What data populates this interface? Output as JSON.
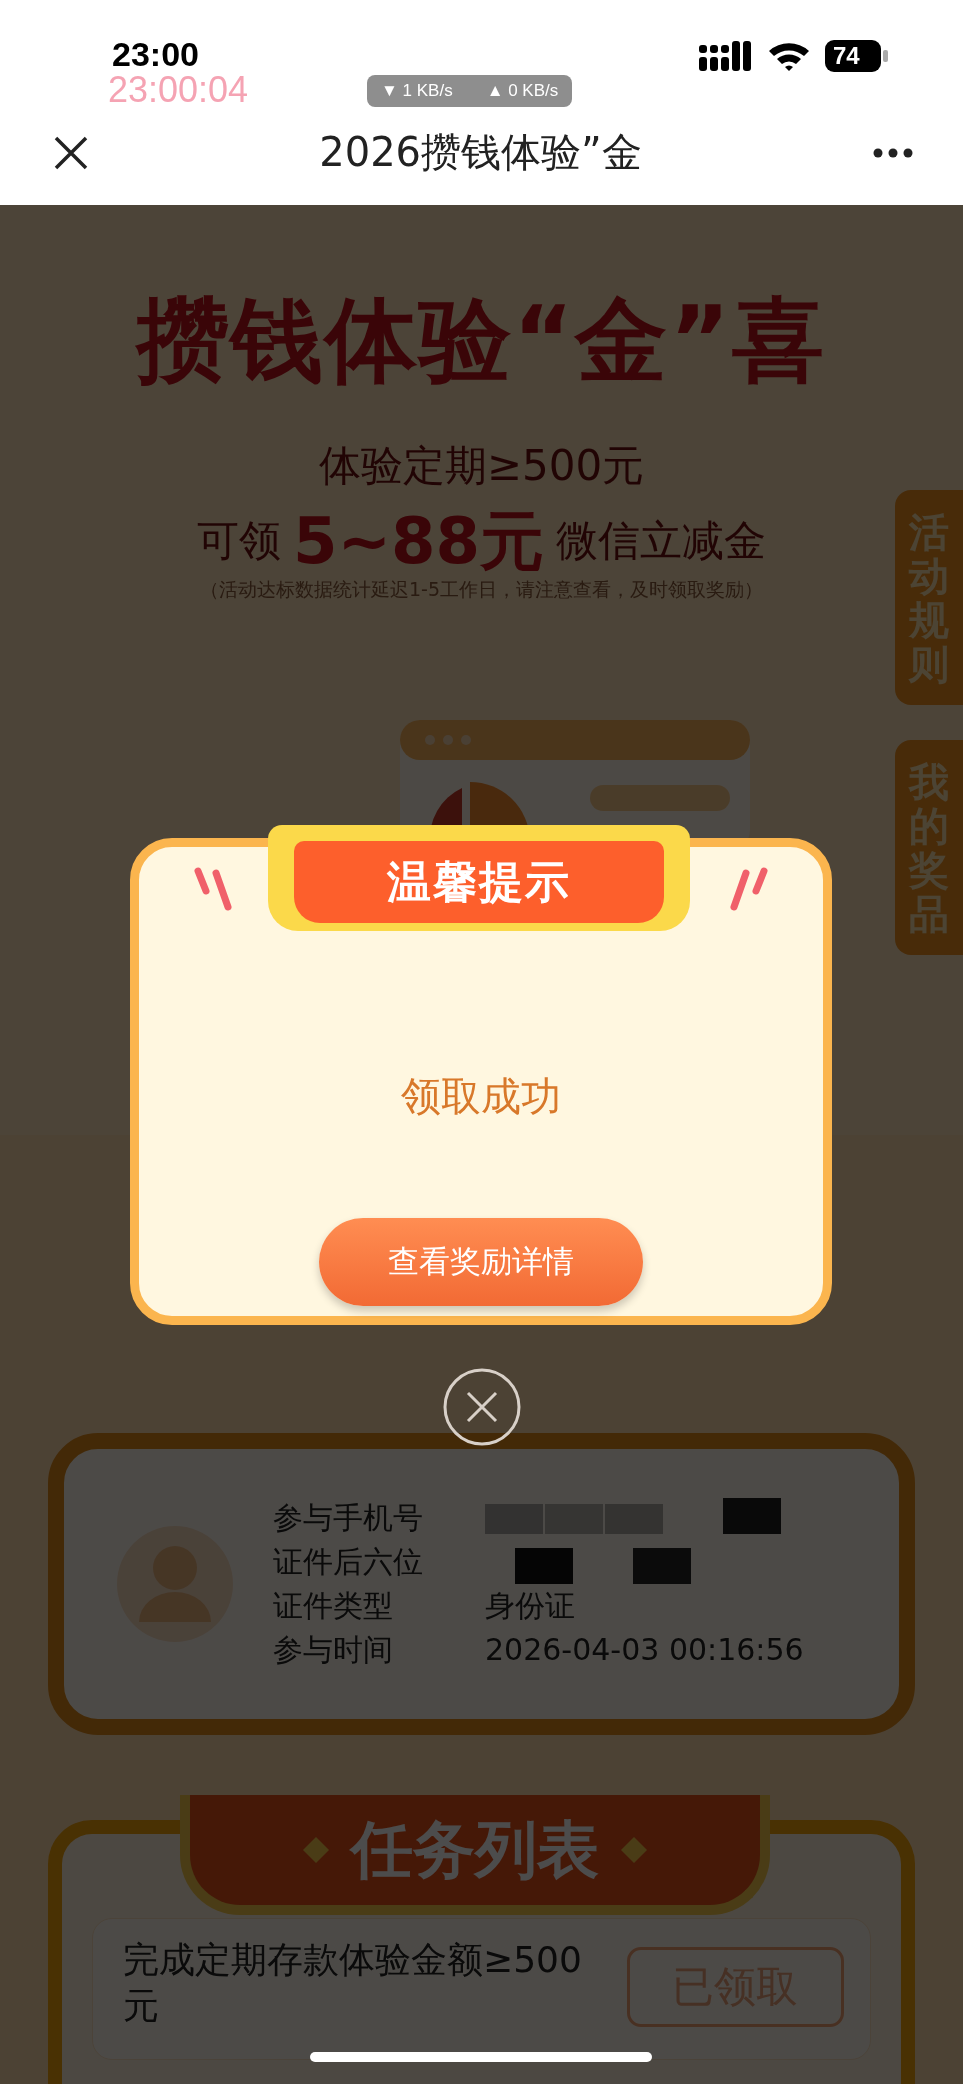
{
  "status_bar": {
    "time": "23:00",
    "overlay_clock": "23:00:04",
    "download_speed": "▼ 1 KB/s",
    "upload_speed": "▲ 0 KB/s",
    "battery": "74"
  },
  "nav_bar": {
    "title": "2026攒钱体验”金"
  },
  "banner": {
    "headline": "攒钱体验“金”喜",
    "subtitle": "体验定期≥500元",
    "offer_prefix": "可领",
    "offer_amount": "5~88元",
    "offer_suffix": "微信立减金",
    "note": "（活动达标数据统计延迟1-5工作日，请注意查看，及时领取奖励）"
  },
  "side_tabs": [
    "活动规则",
    "我的奖品"
  ],
  "profile": {
    "rows": [
      {
        "label": "参与手机号",
        "kind": "redacted"
      },
      {
        "label": "证件后六位",
        "kind": "redacted"
      },
      {
        "label": "证件类型",
        "kind": "text",
        "value": "身份证"
      },
      {
        "label": "参与时间",
        "kind": "text",
        "value": "2026-04-03 00:16:56"
      }
    ]
  },
  "tasks": {
    "title": "任务列表",
    "items": [
      {
        "text": "完成定期存款体验金额≥500元",
        "button": "已领取"
      }
    ]
  },
  "dialog": {
    "title": "温馨提示",
    "message": "领取成功",
    "button": "查看奖励详情"
  }
}
